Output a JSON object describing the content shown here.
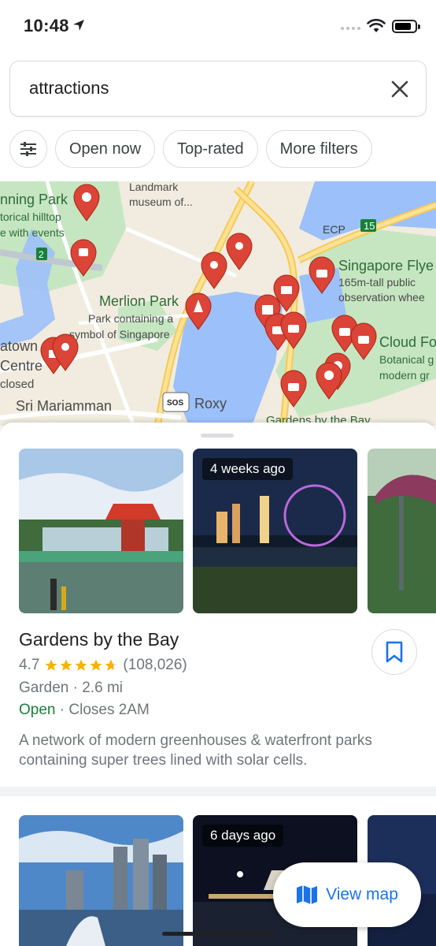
{
  "status_bar": {
    "time": "10:48"
  },
  "search": {
    "query": "attractions"
  },
  "chips": [
    "Open now",
    "Top-rated",
    "More filters"
  ],
  "map": {
    "labels": {
      "landmark": "Landmark",
      "museum": "museum of...",
      "canning": "nning Park",
      "hilltop": "torical hilltop",
      "events": "e with events",
      "merlion": "Merlion Park",
      "merlion_desc1": "Park containing a",
      "merlion_desc2": "symbol of Singapore",
      "flyer": "Singapore Flye",
      "flyer_desc1": "165m-tall public",
      "flyer_desc2": "observation whee",
      "cloud": "Cloud Fo",
      "cloud_desc1": "Botanical g",
      "cloud_desc2": "modern gr",
      "chinatown": "atown",
      "centre": "Centre",
      "closed": "closed",
      "mariamman": "Sri Mariamman",
      "roxy": "Roxy",
      "sos": "SOS",
      "gardens": "Gardens by the Bay",
      "ecp": "ECP",
      "route15": "15",
      "route2": "2"
    }
  },
  "results": [
    {
      "title": "Gardens by the Bay",
      "rating": "4.7",
      "reviews": "(108,026)",
      "type_distance": "Garden · 2.6 mi",
      "open": "Open",
      "closes": "· Closes 2AM",
      "description": "A network of modern greenhouses & waterfront parks containing super trees lined with solar cells.",
      "photo_age": "4 weeks ago"
    },
    {
      "photo_age": "6 days ago"
    }
  ],
  "view_map_label": "View map",
  "colors": {
    "accent": "#1a73e8",
    "open": "#188038",
    "pin": "#db4437",
    "star": "#f5b400"
  }
}
